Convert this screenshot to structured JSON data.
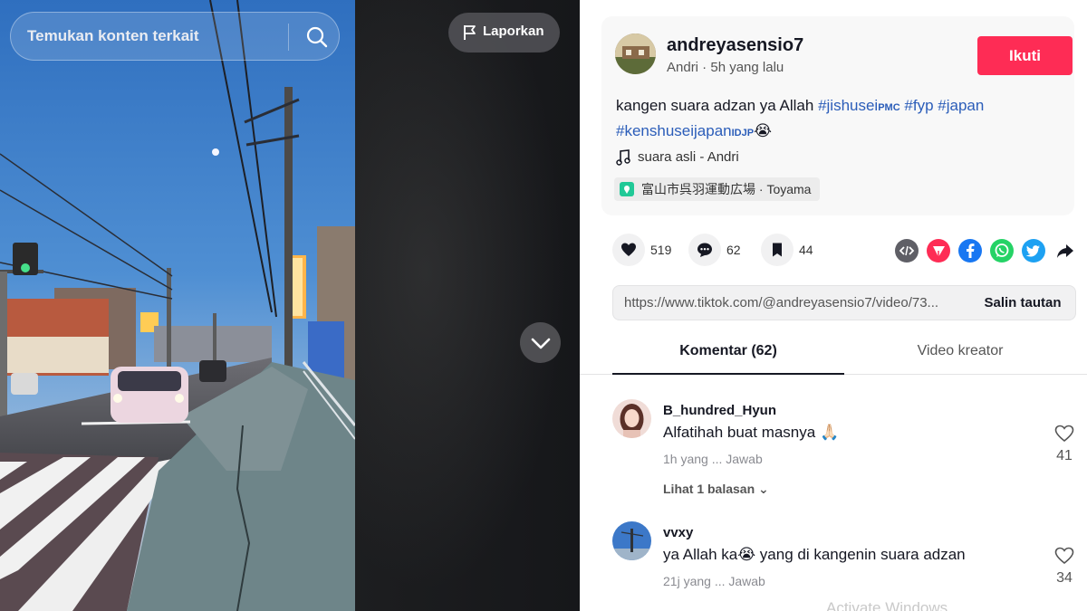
{
  "search": {
    "placeholder": "Temukan konten terkait"
  },
  "video": {
    "report_label": "Laporkan"
  },
  "post": {
    "username": "andreyasensio7",
    "meta": "Andri · 5h yang lalu",
    "follow_label": "Ikuti",
    "caption_text": "kangen suara adzan ya Allah ",
    "hashtags": [
      "#jishusei",
      "#fyp",
      "#japan",
      "#kenshuseijapan"
    ],
    "hashtag_suffixes": [
      "PMC",
      "IDJP"
    ],
    "caption_emoji": "😭",
    "music": "suara asli - Andri",
    "location": "富山市呉羽運動広場 · Toyama"
  },
  "stats": {
    "likes": "519",
    "comments": "62",
    "saves": "44"
  },
  "share_icons": [
    "embed-icon",
    "send-icon",
    "facebook-icon",
    "whatsapp-icon",
    "twitter-icon",
    "share-arrow-icon"
  ],
  "colors": {
    "follow": "#fe2c55",
    "hashtag": "#2b5db9",
    "facebook": "#1877f2",
    "whatsapp": "#25d366",
    "twitter": "#1da1f2",
    "send": "#fe2c55"
  },
  "link": {
    "url": "https://www.tiktok.com/@andreyasensio7/video/73...",
    "copy_label": "Salin tautan"
  },
  "tabs": {
    "comments": "Komentar (62)",
    "creator": "Video kreator"
  },
  "comments": [
    {
      "name": "B_hundred_Hyun",
      "text": "Alfatihah buat masnya 🙏🏻",
      "meta": "1h yang ...   Jawab",
      "likes": "41",
      "replies": "Lihat 1 balasan ⌄"
    },
    {
      "name": "vvxy",
      "text": "ya Allah ka😭 yang di kangenin suara adzan",
      "meta": "21j yang ...   Jawab",
      "likes": "34"
    }
  ],
  "watermark": "Activate Windows"
}
